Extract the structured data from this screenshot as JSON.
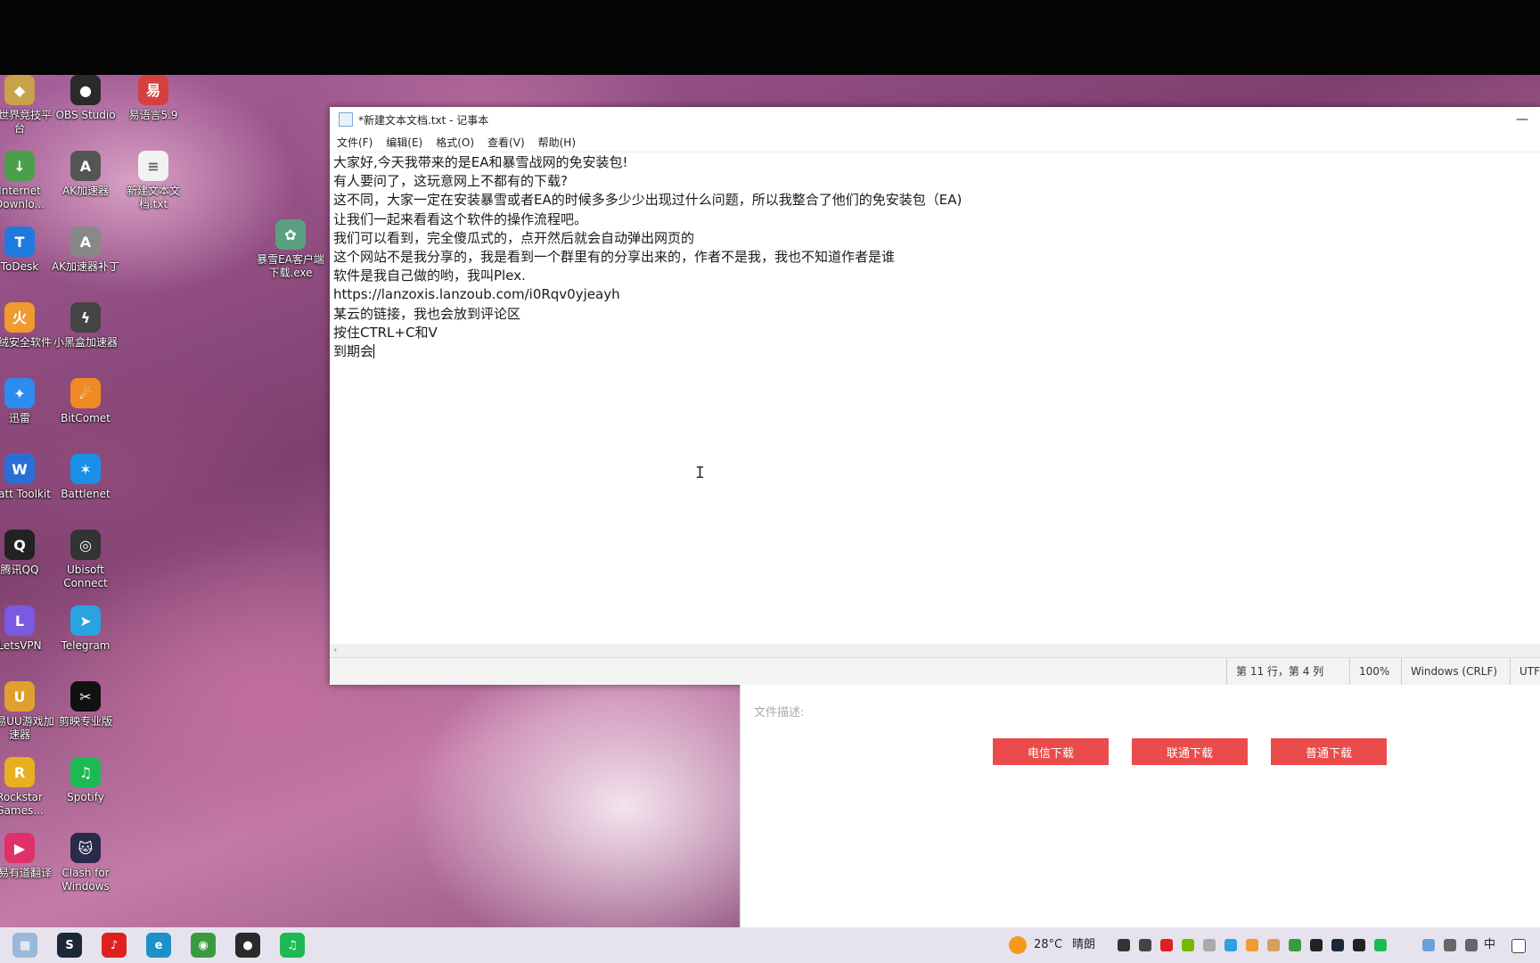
{
  "desktop_icons": [
    {
      "label": "竞世界竞技平台",
      "symbol": "◆",
      "color": "#c8a24a"
    },
    {
      "label": "OBS Studio",
      "symbol": "●",
      "color": "#2a2a2a"
    },
    {
      "label": "易语言5.9",
      "symbol": "易",
      "color": "#d44040"
    },
    {
      "label": "Internet Downlo...",
      "symbol": "↓",
      "color": "#4aa04a"
    },
    {
      "label": "AK加速器",
      "symbol": "A",
      "color": "#555555"
    },
    {
      "label": "新建文本文档.txt",
      "symbol": "≡",
      "color": "#f2f2f2"
    },
    {
      "label": "ToDesk",
      "symbol": "T",
      "color": "#1f7ae0"
    },
    {
      "label": "AK加速器补丁",
      "symbol": "A",
      "color": "#888888"
    },
    {
      "label": "暴雪EA客户端下载.exe",
      "symbol": "✿",
      "color": "#5aa080"
    },
    {
      "label": "火绒安全软件",
      "symbol": "火",
      "color": "#f09a30"
    },
    {
      "label": "小黑盒加速器",
      "symbol": "ϟ",
      "color": "#444444"
    },
    {
      "label": "迅雷",
      "symbol": "✦",
      "color": "#2d8cf0"
    },
    {
      "label": "BitComet",
      "symbol": "☄",
      "color": "#f08a24"
    },
    {
      "label": "Watt Toolkit",
      "symbol": "W",
      "color": "#2a6fd6"
    },
    {
      "label": "Battlenet",
      "symbol": "✶",
      "color": "#1a8fe8"
    },
    {
      "label": "腾讯QQ",
      "symbol": "Q",
      "color": "#222222"
    },
    {
      "label": "Ubisoft Connect",
      "symbol": "◎",
      "color": "#333333"
    },
    {
      "label": "LetsVPN",
      "symbol": "L",
      "color": "#7a5ae0"
    },
    {
      "label": "Telegram",
      "symbol": "➤",
      "color": "#2aa3e0"
    },
    {
      "label": "网易UU游戏加速器",
      "symbol": "U",
      "color": "#e0a030"
    },
    {
      "label": "剪映专业版",
      "symbol": "✂",
      "color": "#111111"
    },
    {
      "label": "Rockstar Games...",
      "symbol": "R",
      "color": "#e8b020"
    },
    {
      "label": "Spotify",
      "symbol": "♫",
      "color": "#1db954"
    },
    {
      "label": "网易有道翻译",
      "symbol": "▶",
      "color": "#e0306a"
    },
    {
      "label": "Clash for Windows",
      "symbol": "🐱",
      "color": "#2a2a4a"
    }
  ],
  "notepad": {
    "title": "*新建文本文档.txt - 记事本",
    "minimize": "—",
    "menu": [
      "文件(F)",
      "编辑(E)",
      "格式(O)",
      "查看(V)",
      "帮助(H)"
    ],
    "lines": [
      "大家好,今天我带来的是EA和暴雪战网的免安装包!",
      "有人要问了，这玩意网上不都有的下载?",
      "这不同，大家一定在安装暴雪或者EA的时候多多少少出现过什么问题，所以我整合了他们的免安装包（EA)",
      "让我们一起来看看这个软件的操作流程吧。",
      "我们可以看到，完全傻瓜式的，点开然后就会自动弹出网页的",
      "这个网站不是我分享的，我是看到一个群里有的分享出来的，作者不是我，我也不知道作者是谁",
      "软件是我自己做的哟，我叫Plex.",
      "https://lanzoxis.lanzoub.com/i0Rqv0yjeayh",
      "某云的链接，我也会放到评论区",
      "按住CTRL+C和V",
      "到期会"
    ],
    "status": {
      "position": "第 11 行，第 4 列",
      "zoom": "100%",
      "line_ending": "Windows (CRLF)",
      "encoding": "UTF-"
    }
  },
  "web_panel": {
    "desc_label": "文件描述:",
    "buttons": [
      "电信下载",
      "联通下载",
      "普通下载"
    ],
    "button_color": "#ea4b4b"
  },
  "taskbar": {
    "apps": [
      {
        "name": "file-explorer",
        "symbol": "▦",
        "color": "#9ab8d8"
      },
      {
        "name": "steam",
        "symbol": "S",
        "color": "#1b2838"
      },
      {
        "name": "netease-music",
        "symbol": "♪",
        "color": "#e02020"
      },
      {
        "name": "edge",
        "symbol": "e",
        "color": "#1e90c8"
      },
      {
        "name": "chrome",
        "symbol": "◉",
        "color": "#3a9a40"
      },
      {
        "name": "obs",
        "symbol": "●",
        "color": "#2a2a2a"
      },
      {
        "name": "spotify",
        "symbol": "♫",
        "color": "#1db954"
      }
    ],
    "weather_temp": "28°C",
    "weather_text": "晴朗",
    "ime": "中"
  }
}
